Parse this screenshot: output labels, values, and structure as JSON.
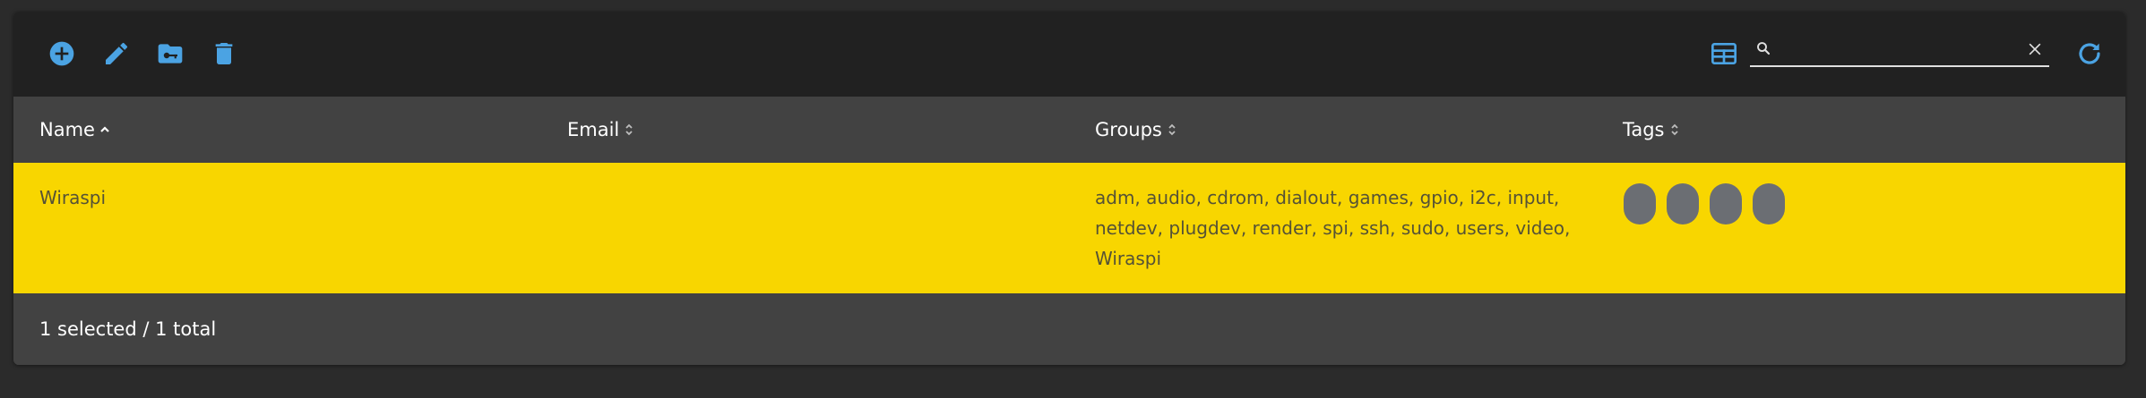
{
  "colors": {
    "accent": "#4ba3e3",
    "row_selected": "#f8d600",
    "tag_chip": "#6b6e73",
    "toolbar_bg": "#212121",
    "table_bg": "#424242"
  },
  "toolbar": {
    "icons": [
      "add-circle-icon",
      "edit-pencil-icon",
      "folder-key-icon",
      "trash-icon",
      "table-columns-icon",
      "search-icon",
      "close-icon",
      "refresh-icon"
    ],
    "search": {
      "value": "",
      "placeholder": ""
    }
  },
  "table": {
    "columns": [
      {
        "label": "Name",
        "sort": "ascending"
      },
      {
        "label": "Email",
        "sort": "none"
      },
      {
        "label": "Groups",
        "sort": "none"
      },
      {
        "label": "Tags",
        "sort": "none"
      }
    ],
    "rows": [
      {
        "name": "Wiraspi",
        "email": "",
        "groups": "adm, audio, cdrom, dialout, games, gpio, i2c, input, netdev, plugdev, render, spi, ssh, sudo, users, video, Wiraspi",
        "tags_count": 4,
        "selected": true
      }
    ]
  },
  "footer": {
    "status": "1 selected / 1 total"
  }
}
